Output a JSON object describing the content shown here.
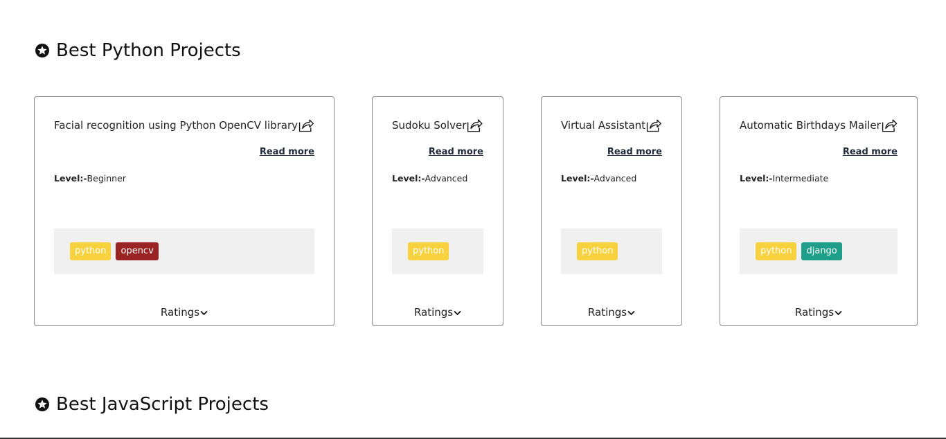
{
  "sections": [
    {
      "title": "Best Python Projects",
      "icon": "star-circle-icon"
    },
    {
      "title": "Best JavaScript Projects",
      "icon": "star-circle-icon"
    }
  ],
  "cards": [
    {
      "title": "Facial recognition using Python OpenCV library",
      "read_more": "Read more",
      "level_label": "Level:-",
      "level_value": "Beginner",
      "tags": [
        "python",
        "opencv"
      ],
      "ratings": "Ratings"
    },
    {
      "title": "Sudoku Solver",
      "read_more": "Read more",
      "level_label": "Level:-",
      "level_value": "Advanced",
      "tags": [
        "python"
      ],
      "ratings": "Ratings"
    },
    {
      "title": "Virtual Assistant",
      "read_more": "Read more",
      "level_label": "Level:-",
      "level_value": "Advanced",
      "tags": [
        "python"
      ],
      "ratings": "Ratings"
    },
    {
      "title": "Automatic Birthdays Mailer",
      "read_more": "Read more",
      "level_label": "Level:-",
      "level_value": "Intermediate",
      "tags": [
        "python",
        "django"
      ],
      "ratings": "Ratings"
    }
  ],
  "colors": {
    "python_tag": "#f7d23e",
    "opencv_tag": "#9a2424",
    "django_tag": "#1f9f8a",
    "tag_box_bg": "#f0f0f0",
    "card_border": "#8a8a8a"
  }
}
